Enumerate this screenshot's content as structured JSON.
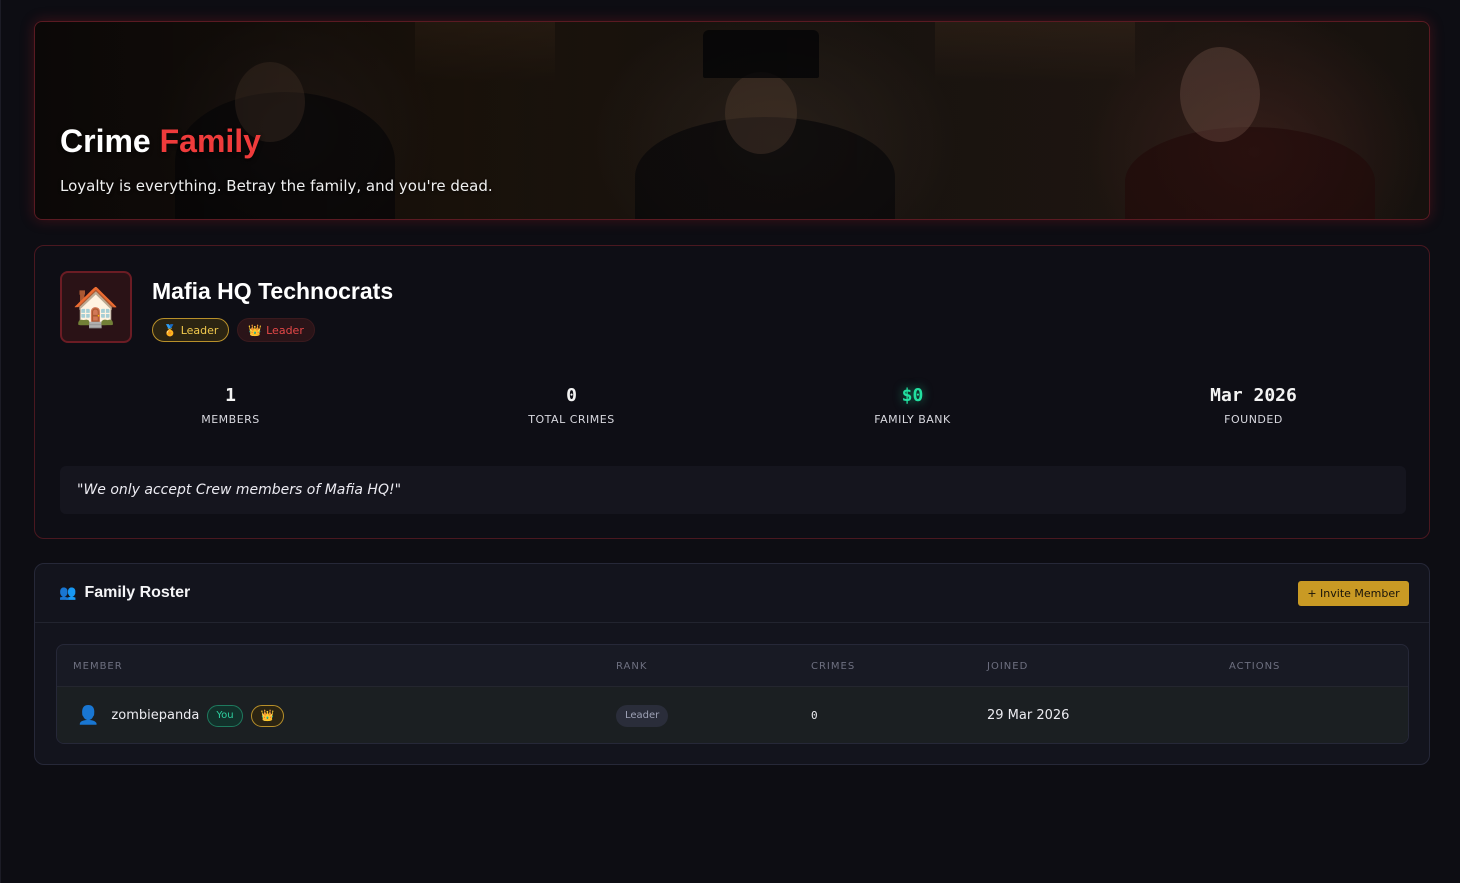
{
  "hero": {
    "title_main": "Crime",
    "title_accent": "Family",
    "subtitle": "Loyalty is everything. Betray the family, and you're dead."
  },
  "family": {
    "emblem_icon": "🏠",
    "name": "Mafia HQ Technocrats",
    "badges": [
      {
        "icon": "🏅",
        "label": "Leader"
      },
      {
        "icon": "👑",
        "label": "Leader"
      }
    ],
    "stats": [
      {
        "value": "1",
        "label": "MEMBERS"
      },
      {
        "value": "0",
        "label": "TOTAL CRIMES"
      },
      {
        "value": "$0",
        "label": "FAMILY BANK"
      },
      {
        "value": "Mar 2026",
        "label": "FOUNDED"
      }
    ],
    "motto": "\"We only accept Crew members of Mafia HQ!\""
  },
  "roster": {
    "icon": "👥",
    "title": "Family Roster",
    "invite_label": "+ Invite Member",
    "columns": [
      "MEMBER",
      "RANK",
      "CRIMES",
      "JOINED",
      "ACTIONS"
    ],
    "rows": [
      {
        "avatar_icon": "👤",
        "member": "zombiepanda",
        "you_label": "You",
        "crown_icon": "👑",
        "rank": "Leader",
        "crimes": "0",
        "joined": "29 Mar 2026",
        "actions": ""
      }
    ]
  },
  "colors": {
    "accent_red": "#ef3b3b",
    "gold": "#c99a24",
    "money_green": "#22e0a0",
    "background": "#0d0d13"
  }
}
